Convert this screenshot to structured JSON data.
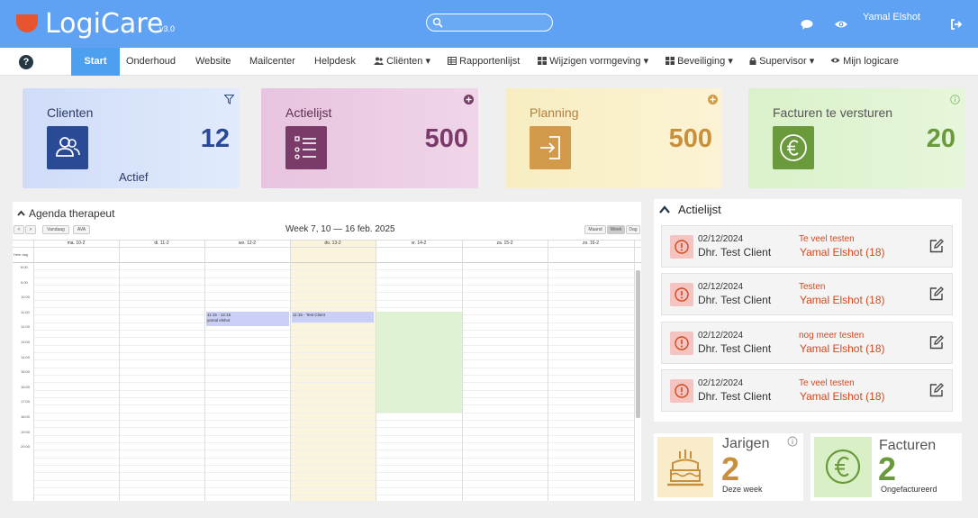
{
  "app": {
    "name": "LogiCare",
    "version": "v3.0"
  },
  "header": {
    "search_placeholder": "",
    "user_name": "Yamal Elshot"
  },
  "nav": {
    "items": [
      {
        "label": "Start"
      },
      {
        "label": "Onderhoud"
      },
      {
        "label": "Website"
      },
      {
        "label": "Mailcenter"
      },
      {
        "label": "Helpdesk"
      },
      {
        "label": "Cliënten ▾"
      },
      {
        "label": "Rapportenlijst"
      },
      {
        "label": "Wijzigen vormgeving ▾"
      },
      {
        "label": "Beveiliging ▾"
      },
      {
        "label": "Supervisor ▾"
      },
      {
        "label": "Mijn logicare"
      }
    ]
  },
  "cards": [
    {
      "title": "Clienten",
      "value": "12",
      "sub": "Actief",
      "corner_icon": "filter-icon",
      "icon": "users-icon",
      "color": "#2a4a96"
    },
    {
      "title": "Actielijst",
      "value": "500",
      "corner_icon": "plus-circle-icon",
      "icon": "list-icon",
      "color": "#7a3a6a"
    },
    {
      "title": "Planning",
      "value": "500",
      "corner_icon": "plus-circle-icon",
      "icon": "sign-in-icon",
      "color": "#c8903c"
    },
    {
      "title": "Facturen te versturen",
      "value": "20",
      "corner_icon": "info-icon",
      "icon": "euro-icon",
      "color": "#6a9a3c"
    }
  ],
  "agenda": {
    "title": "Agenda therapeut",
    "week_label": "Week 7, 10 — 16 feb. 2025",
    "buttons": {
      "prev": "<",
      "next": ">",
      "today": "Vandaag",
      "ava": "AVA",
      "month": "Maand",
      "week": "Week",
      "day": "Dag"
    },
    "day_headers": [
      "ma. 10-2",
      "di. 11-2",
      "wo. 12-2",
      "do. 13-2",
      "vr. 14-2",
      "za. 15-2",
      "zo. 16-2"
    ],
    "allday_label": "Hele dag",
    "hours": [
      "8:00",
      "9:00",
      "10:00",
      "11:00",
      "12:00",
      "13:00",
      "14:00",
      "15:00",
      "16:00",
      "17:00",
      "18:00",
      "19:00",
      "20:00"
    ],
    "events": [
      {
        "time": "11:15 - 12:15",
        "title": "yamal elshot"
      },
      {
        "time": "11:15 - Test Client",
        "title": ""
      }
    ]
  },
  "actielijst": {
    "title": "Actielijst",
    "items": [
      {
        "date": "02/12/2024",
        "client": "Dhr. Test Client",
        "subject": "Te veel testen",
        "who": "Yamal Elshot (18)"
      },
      {
        "date": "02/12/2024",
        "client": "Dhr. Test Client",
        "subject": "Testen",
        "who": "Yamal Elshot (18)"
      },
      {
        "date": "02/12/2024",
        "client": "Dhr. Test Client",
        "subject": "nog meer testen",
        "who": "Yamal Elshot (18)"
      },
      {
        "date": "02/12/2024",
        "client": "Dhr. Test Client",
        "subject": "Te veel testen",
        "who": "Yamal Elshot (18)"
      }
    ]
  },
  "jarigen": {
    "title": "Jarigen",
    "value": "2",
    "sub": "Deze week",
    "icon": "birthday-cake-icon"
  },
  "facturen": {
    "title": "Facturen",
    "value": "2",
    "sub": "Ongefactureerd",
    "icon": "euro-icon"
  }
}
